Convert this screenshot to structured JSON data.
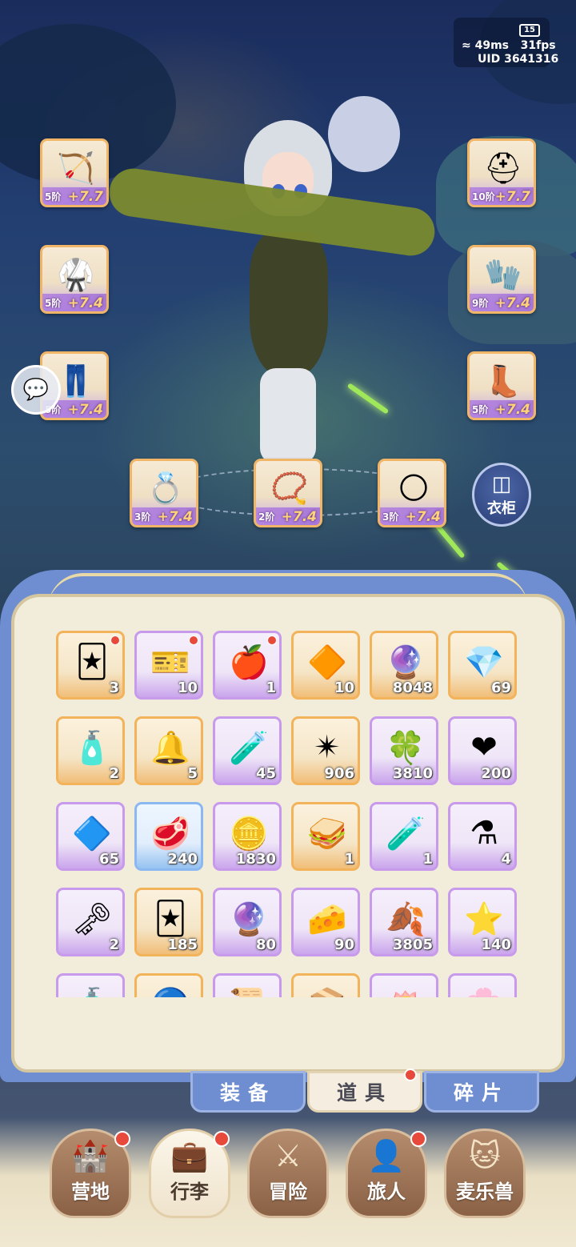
{
  "status": {
    "battery": "15",
    "ping": "49ms",
    "fps": "31fps",
    "uid": "UID 3641316"
  },
  "equipment": [
    {
      "slot": "weapon",
      "icon": "bow-icon",
      "tier": "5阶",
      "enhance": "+7.7"
    },
    {
      "slot": "armor",
      "icon": "armor-icon",
      "tier": "5阶",
      "enhance": "+7.4"
    },
    {
      "slot": "pants",
      "icon": "pants-icon",
      "tier": "5阶",
      "enhance": "+7.4"
    },
    {
      "slot": "helmet",
      "icon": "helmet-icon",
      "tier": "10阶",
      "enhance": "+7.7"
    },
    {
      "slot": "gloves",
      "icon": "gloves-icon",
      "tier": "9阶",
      "enhance": "+7.4"
    },
    {
      "slot": "boots",
      "icon": "boots-icon",
      "tier": "5阶",
      "enhance": "+7.4"
    },
    {
      "slot": "ring",
      "icon": "ring-icon",
      "tier": "3阶",
      "enhance": "+7.4"
    },
    {
      "slot": "necklace",
      "icon": "necklace-icon",
      "tier": "2阶",
      "enhance": "+7.4"
    },
    {
      "slot": "earring",
      "icon": "earring-icon",
      "tier": "3阶",
      "enhance": "+7.4"
    }
  ],
  "wardrobe": {
    "label": "衣柜"
  },
  "inventory": [
    {
      "icon": "card-icon",
      "glyph": "🃏",
      "count": "3",
      "rarity": "orange",
      "badge": true
    },
    {
      "icon": "ticket-icon",
      "glyph": "🎫",
      "count": "10",
      "rarity": "purple",
      "badge": true
    },
    {
      "icon": "apple-icon",
      "glyph": "🍎",
      "count": "1",
      "rarity": "purple",
      "badge": true
    },
    {
      "icon": "gold-gem-icon",
      "glyph": "🔶",
      "count": "10",
      "rarity": "orange",
      "badge": false
    },
    {
      "icon": "orb-icon",
      "glyph": "🔮",
      "count": "8048",
      "rarity": "orange",
      "badge": false
    },
    {
      "icon": "crystal-icon",
      "glyph": "💎",
      "count": "69",
      "rarity": "orange",
      "badge": false
    },
    {
      "icon": "rainbow-bottle-icon",
      "glyph": "🧴",
      "count": "2",
      "rarity": "orange",
      "badge": false
    },
    {
      "icon": "bell-icon",
      "glyph": "🔔",
      "count": "5",
      "rarity": "orange",
      "badge": false
    },
    {
      "icon": "potion-icon",
      "glyph": "🧪",
      "count": "45",
      "rarity": "purple",
      "badge": false
    },
    {
      "icon": "star-icon",
      "glyph": "✴",
      "count": "906",
      "rarity": "orange",
      "badge": false
    },
    {
      "icon": "clover-coin-icon",
      "glyph": "🍀",
      "count": "3810",
      "rarity": "purple",
      "badge": false
    },
    {
      "icon": "heart-icon",
      "glyph": "❤",
      "count": "200",
      "rarity": "purple",
      "badge": false
    },
    {
      "icon": "purple-gem-icon",
      "glyph": "🔷",
      "count": "65",
      "rarity": "purple",
      "badge": false
    },
    {
      "icon": "meat-icon",
      "glyph": "🥩",
      "count": "240",
      "rarity": "blue",
      "badge": false
    },
    {
      "icon": "heart-coin-icon",
      "glyph": "🪙",
      "count": "1830",
      "rarity": "purple",
      "badge": false
    },
    {
      "icon": "sandwich-icon",
      "glyph": "🥪",
      "count": "1",
      "rarity": "orange",
      "badge": false
    },
    {
      "icon": "blue-bottle-icon",
      "glyph": "🧪",
      "count": "1",
      "rarity": "purple",
      "badge": false
    },
    {
      "icon": "red-flask-icon",
      "glyph": "⚗",
      "count": "4",
      "rarity": "purple",
      "badge": false
    },
    {
      "icon": "key-icon",
      "glyph": "🗝",
      "count": "2",
      "rarity": "purple",
      "badge": false
    },
    {
      "icon": "blue-card-icon",
      "glyph": "🃏",
      "count": "185",
      "rarity": "orange",
      "badge": false
    },
    {
      "icon": "cat-eye-orb-icon",
      "glyph": "🔮",
      "count": "80",
      "rarity": "purple",
      "badge": false
    },
    {
      "icon": "cheese-icon",
      "glyph": "🧀",
      "count": "90",
      "rarity": "purple",
      "badge": false
    },
    {
      "icon": "gold-leaf-icon",
      "glyph": "🍂",
      "count": "3805",
      "rarity": "purple",
      "badge": false
    },
    {
      "icon": "star-cookie-icon",
      "glyph": "⭐",
      "count": "140",
      "rarity": "purple",
      "badge": false
    },
    {
      "icon": "partial-item-icon",
      "glyph": "🧴",
      "count": "",
      "rarity": "purple",
      "badge": false
    },
    {
      "icon": "partial-item-icon",
      "glyph": "🔵",
      "count": "",
      "rarity": "orange",
      "badge": false
    },
    {
      "icon": "partial-item-icon",
      "glyph": "📜",
      "count": "",
      "rarity": "purple",
      "badge": false
    },
    {
      "icon": "partial-item-icon",
      "glyph": "📦",
      "count": "",
      "rarity": "orange",
      "badge": false
    },
    {
      "icon": "partial-item-icon",
      "glyph": "🪷",
      "count": "",
      "rarity": "purple",
      "badge": false
    },
    {
      "icon": "partial-item-icon",
      "glyph": "🌸",
      "count": "",
      "rarity": "purple",
      "badge": false
    }
  ],
  "tabs": [
    {
      "label": "装备",
      "active": false
    },
    {
      "label": "道具",
      "active": true
    },
    {
      "label": "碎片",
      "active": false
    }
  ],
  "nav": [
    {
      "label": "营地",
      "icon": "castle-icon",
      "active": false
    },
    {
      "label": "行李",
      "icon": "backpack-icon",
      "active": true
    },
    {
      "label": "冒险",
      "icon": "crossed-swords-icon",
      "active": false
    },
    {
      "label": "旅人",
      "icon": "traveler-portrait-icon",
      "active": false
    },
    {
      "label": "麦乐兽",
      "icon": "cat-icon",
      "active": false
    }
  ]
}
